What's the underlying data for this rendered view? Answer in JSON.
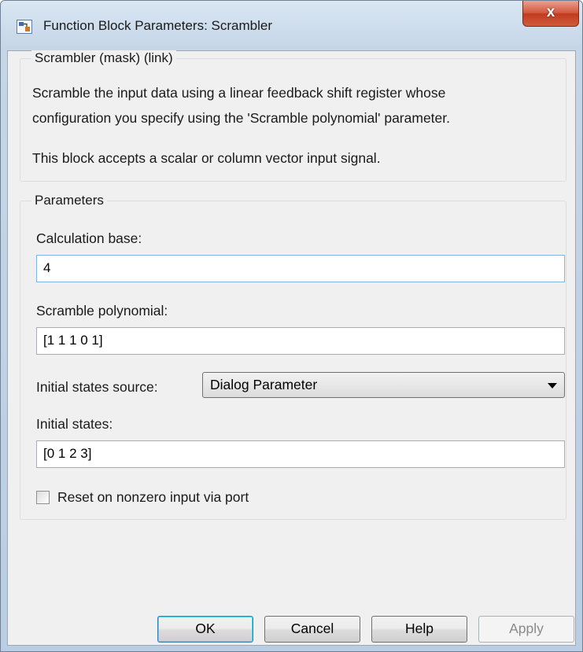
{
  "window": {
    "title": "Function Block Parameters: Scrambler",
    "close_glyph": "x"
  },
  "mask_group": {
    "legend": "Scrambler (mask) (link)",
    "description_line1": "Scramble the input data using a linear feedback shift register whose",
    "description_line2": "configuration you specify using the 'Scramble polynomial' parameter.",
    "description_line3": "This block accepts a scalar or column vector input signal."
  },
  "parameters": {
    "legend": "Parameters",
    "calculation_base_label": "Calculation base:",
    "calculation_base_value": "4",
    "scramble_polynomial_label": "Scramble polynomial:",
    "scramble_polynomial_value": "[1 1 1 0 1]",
    "initial_states_source_label": "Initial states source:",
    "initial_states_source_value": "Dialog Parameter",
    "initial_states_label": "Initial states:",
    "initial_states_value": "[0 1 2 3]",
    "reset_label": "Reset on nonzero input via port",
    "reset_checked": false
  },
  "buttons": {
    "ok": "OK",
    "cancel": "Cancel",
    "help": "Help",
    "apply": "Apply"
  },
  "colors": {
    "close_button": "#c23a1f",
    "default_button_border": "#3c7fb1",
    "focus_border": "#7eb4ea"
  },
  "icons": {
    "app": "simulink-block-icon",
    "close": "close-icon",
    "dropdown": "chevron-down-icon"
  }
}
